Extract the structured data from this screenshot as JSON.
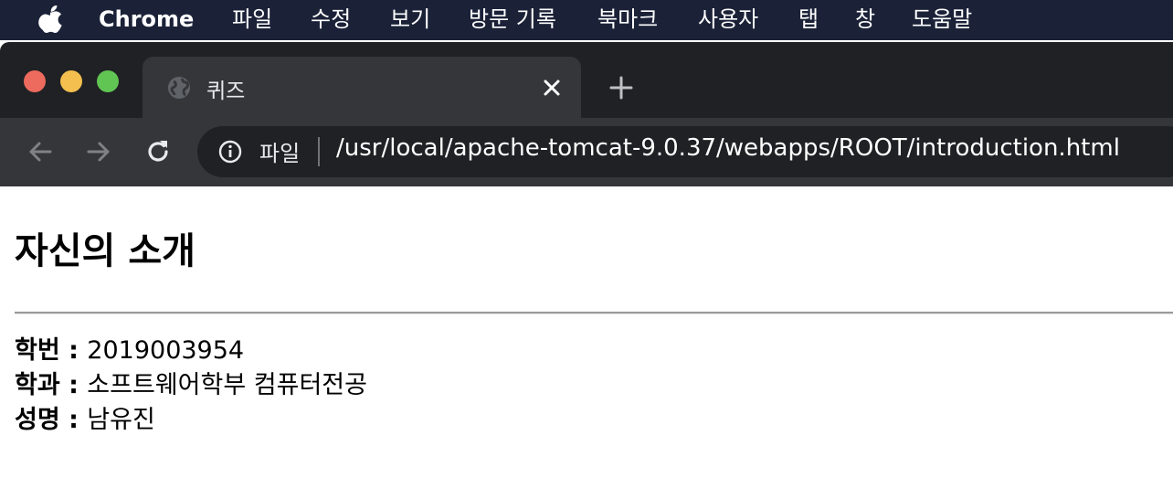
{
  "menubar": {
    "app_name": "Chrome",
    "items": [
      "파일",
      "수정",
      "보기",
      "방문 기록",
      "북마크",
      "사용자",
      "탭",
      "창",
      "도움말"
    ]
  },
  "browser": {
    "tab": {
      "title": "퀴즈"
    },
    "omnibox": {
      "scheme_label": "파일",
      "url": "/usr/local/apache-tomcat-9.0.37/webapps/ROOT/introduction.html"
    },
    "colors": {
      "close_light": "#ed6a5e",
      "minimize_light": "#f4bf4f",
      "zoom_light": "#61c554"
    }
  },
  "page": {
    "title": "자신의 소개",
    "fields": [
      {
        "label": "학번",
        "separator": " : ",
        "value": "2019003954"
      },
      {
        "label": "학과",
        "separator": " : ",
        "value": "소프트웨어학부 컴퓨터전공"
      },
      {
        "label": "성명",
        "separator": " : ",
        "value": "남유진"
      }
    ]
  }
}
